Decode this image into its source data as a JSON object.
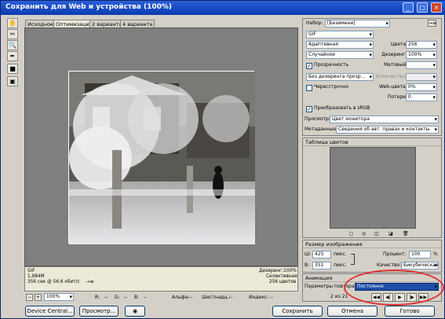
{
  "window": {
    "title": "Сохранить для Web и устройства (100%)"
  },
  "titlebuttons": {
    "min": "_",
    "max": "□",
    "close": "×"
  },
  "tools": {
    "hand": "✋",
    "slice": "✂",
    "zoom": "🔍",
    "eyedrop": "✒",
    "swatch": "■",
    "toggle": "▣"
  },
  "tabs": [
    "Исходное",
    "Оптимизация",
    "2 варианта",
    "4 варианта"
  ],
  "info": {
    "left": [
      "GIF",
      "1,984M",
      "356 сек @ 56.6 кбит/с"
    ],
    "right": [
      "Дизеринг:100%",
      "Селективная",
      "256 цветов"
    ],
    "menu_glyph": "→≡"
  },
  "zoom": {
    "value": "100%",
    "minus": "−",
    "plus": "+"
  },
  "readouts": {
    "r": "R:",
    "g": "G:",
    "b": "B:",
    "alpha": "Альфа:",
    "hex": "Шестнадц.:",
    "index": "Индекс:"
  },
  "dash": "--",
  "settings": {
    "preset_label": "Набор:",
    "preset_value": "[Безимени]",
    "format": "GIF",
    "reduction": "Адаптивная",
    "colors_label": "Цвета:",
    "colors_value": "256",
    "dither_algo": "Случайное",
    "dither_label": "Дизеринг:",
    "dither_value": "100%",
    "transparency_label": "Прозрачность",
    "matte_label": "Матовый:",
    "transp_dither": "Без дизеринга прозр...",
    "amount_label": "Количество:",
    "interlaced_label": "Чересстрочно",
    "websnap_label": "Web-цвета:",
    "websnap_value": "0%",
    "lossy_label": "Потери:",
    "lossy_value": "0",
    "convert_label": "Преобразовать в sRGB",
    "preview_label": "Просмотр:",
    "preview_value": "Цвет монитора",
    "metadata_label": "Метаданные:",
    "metadata_value": "Сведения об авт. правах и контакты",
    "check": "✓"
  },
  "color_table": {
    "header": "Таблица цветов",
    "icons": [
      "◻",
      "◎",
      "◫",
      "◪",
      "🗑"
    ]
  },
  "image_size": {
    "header": "Размер изображения",
    "w_label": "Ш:",
    "w_value": "425",
    "h_label": "В:",
    "h_value": "351",
    "unit": "пикс.",
    "percent_label": "Процент:",
    "percent_value": "100",
    "percent_unit": "%",
    "quality_label": "Качество:",
    "quality_value": "Бикубическая"
  },
  "animation": {
    "header": "Анимация",
    "loop_label": "Параметры повтора:",
    "loop_value": "Постоянно",
    "frame": "2 из 21",
    "nav": [
      "◀◀",
      "◀|",
      "▶",
      "|▶",
      "▶▶"
    ]
  },
  "buttons": {
    "device_central": "Device Central...",
    "preview": "Просмотр...",
    "save": "Сохранить",
    "cancel": "Отмена",
    "done": "Готово",
    "browser_icon": "◉"
  }
}
